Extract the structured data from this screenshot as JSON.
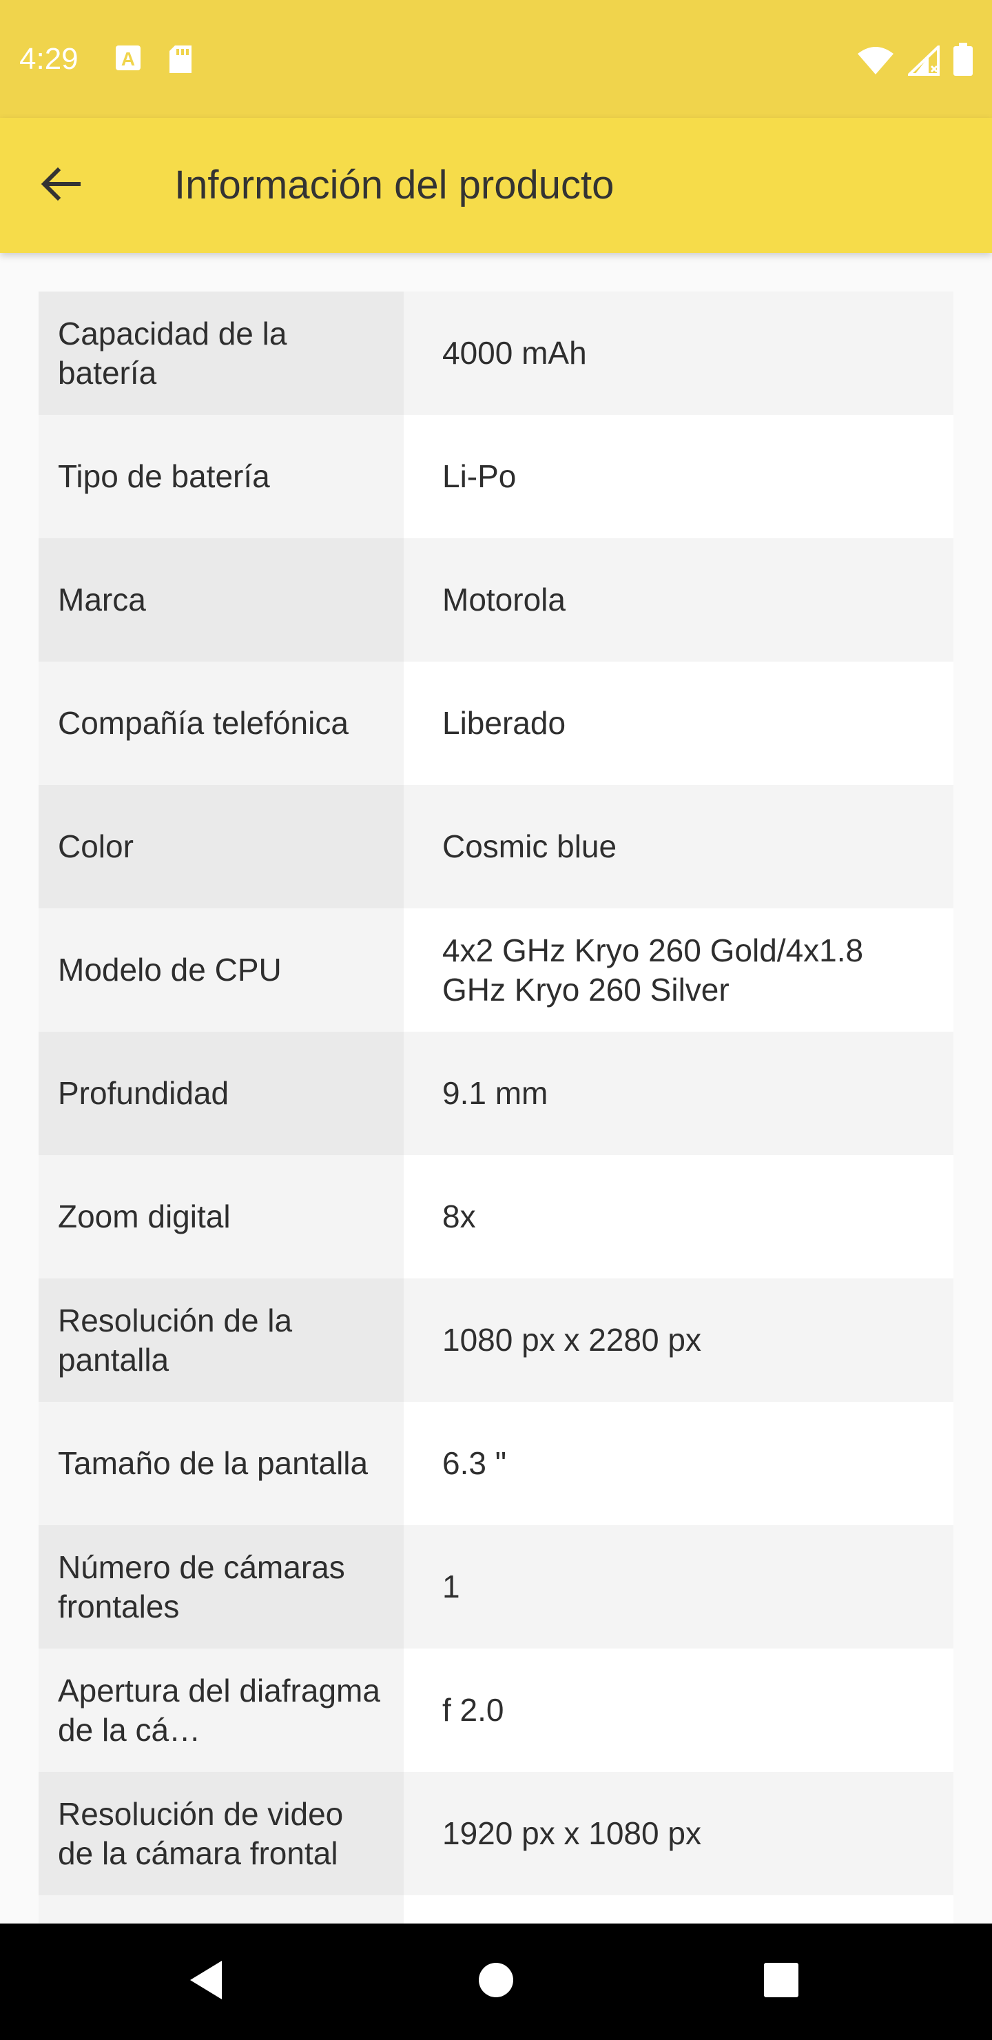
{
  "status_bar": {
    "time": "4:29",
    "icons_left": [
      "font-download-icon",
      "sd-card-icon"
    ],
    "icons_right": [
      "wifi-icon",
      "cell-signal-icon",
      "battery-icon"
    ]
  },
  "app_bar": {
    "title": "Información del producto",
    "back_icon": "arrow-back-icon"
  },
  "specs": [
    {
      "label": "Capacidad de la batería",
      "value": "4000 mAh"
    },
    {
      "label": "Tipo de batería",
      "value": "Li-Po"
    },
    {
      "label": "Marca",
      "value": "Motorola"
    },
    {
      "label": "Compañía telefónica",
      "value": "Liberado"
    },
    {
      "label": "Color",
      "value": "Cosmic blue"
    },
    {
      "label": "Modelo de CPU",
      "value": "4x2 GHz Kryo 260 Gold/4x1.8 GHz Kryo 260 Silver"
    },
    {
      "label": "Profundidad",
      "value": "9.1 mm"
    },
    {
      "label": "Zoom digital",
      "value": "8x"
    },
    {
      "label": "Resolución de la pantalla",
      "value": "1080 px x 2280 px"
    },
    {
      "label": "Tamaño de la pantalla",
      "value": "6.3 \""
    },
    {
      "label": "Número de cámaras frontales",
      "value": "1"
    },
    {
      "label": "Apertura del diafragma de la cá…",
      "value": "f 2.0"
    },
    {
      "label": "Resolución de video de la cámara frontal",
      "value": "1920 px x 1080 px"
    },
    {
      "label": "",
      "value": ""
    }
  ],
  "nav_bar": {
    "icons": [
      "back-triangle-icon",
      "home-circle-icon",
      "recents-square-icon"
    ]
  },
  "colors": {
    "status_bar": "#f0d44c",
    "app_bar": "#f6dc4a",
    "text": "#333333"
  }
}
